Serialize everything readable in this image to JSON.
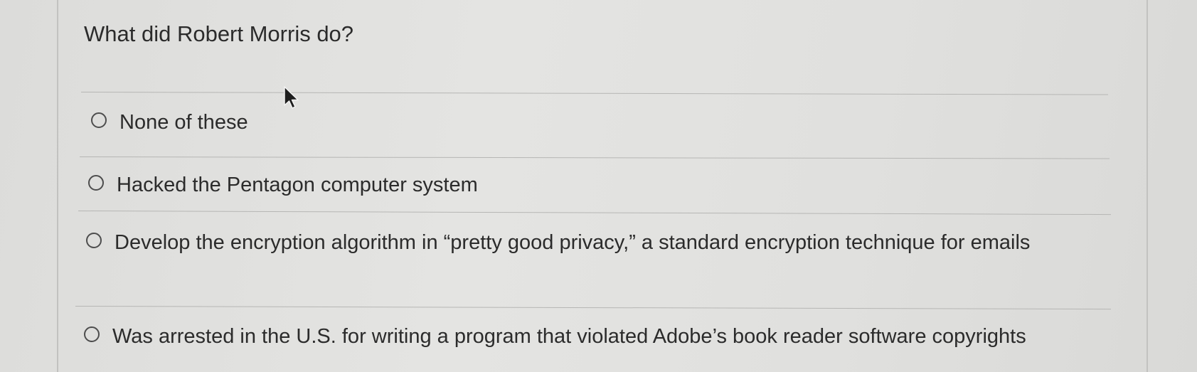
{
  "question": {
    "title": "What did Robert Morris do?"
  },
  "options": [
    {
      "label": "None of these",
      "selected": false
    },
    {
      "label": "Hacked the Pentagon computer system",
      "selected": false
    },
    {
      "label": "Develop the encryption algorithm in “pretty good privacy,” a standard encryption technique for emails",
      "selected": false
    },
    {
      "label": "Was arrested in the U.S. for writing a program that violated Adobe’s book reader software copyrights",
      "selected": false
    }
  ],
  "icons": {
    "cursor": "mouse-pointer-icon",
    "radio": "radio-unselected"
  },
  "colors": {
    "background": "#e0e0de",
    "text": "#2b2b2b",
    "divider": "#b6b6b4"
  }
}
